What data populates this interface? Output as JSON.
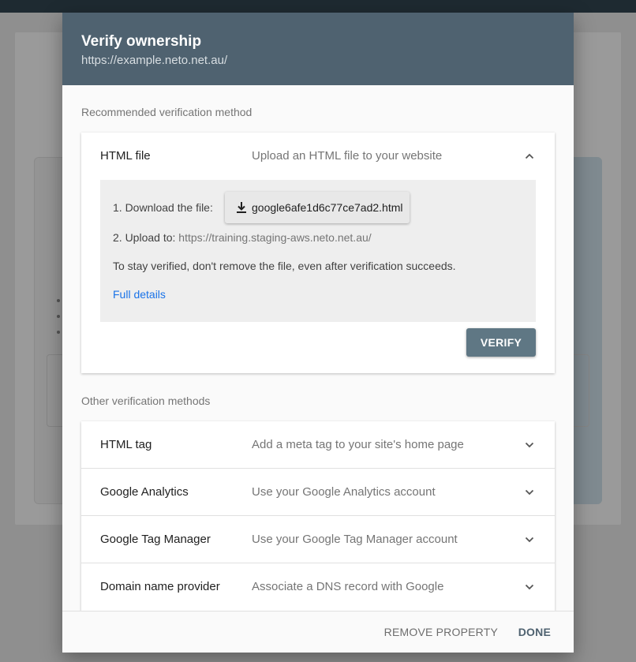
{
  "dialog": {
    "title": "Verify ownership",
    "subtitle": "https://example.neto.net.au/"
  },
  "recommended": {
    "label": "Recommended verification method",
    "method": {
      "name": "HTML file",
      "description": "Upload an HTML file to your website",
      "expanded": true,
      "step1_label": "1. Download the file:",
      "download_filename": "google6afe1d6c77ce7ad2.html",
      "step2_label": "2. Upload to:",
      "step2_url": "https://training.staging-aws.neto.net.au/",
      "note": "To stay verified, don't remove the file, even after verification succeeds.",
      "details_link": "Full details",
      "verify_label": "VERIFY"
    }
  },
  "other": {
    "label": "Other verification methods",
    "methods": [
      {
        "name": "HTML tag",
        "description": "Add a meta tag to your site's home page"
      },
      {
        "name": "Google Analytics",
        "description": "Use your Google Analytics account"
      },
      {
        "name": "Google Tag Manager",
        "description": "Use your Google Tag Manager account"
      },
      {
        "name": "Domain name provider",
        "description": "Associate a DNS record with Google"
      }
    ]
  },
  "footer": {
    "remove_label": "REMOVE PROPERTY",
    "done_label": "DONE"
  },
  "colors": {
    "header": "#4f6270",
    "verify_button": "#5f7784",
    "link": "#1a73e8"
  }
}
